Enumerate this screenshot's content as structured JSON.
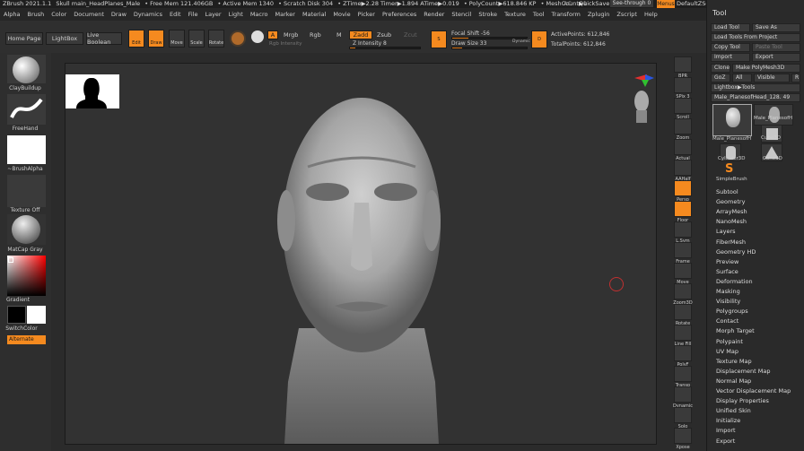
{
  "titlebar": {
    "app": "ZBrush 2021.1.1",
    "file": "Skull main_HeadPlanes_Male",
    "free_mem": "• Free Mem 121.406GB",
    "active_mem": "• Active Mem 1340",
    "scratch": "• Scratch Disk 304",
    "ztime": "• ZTime▶2.28 Timer▶1.894 ATime▶0.019",
    "polycount": "• PolyCount▶618.846 KP",
    "meshcount": "• MeshCount▶1",
    "ac": "AC",
    "quicksave": "QuickSave",
    "see_through": "See-through  0",
    "menus": "Menus",
    "script": "DefaultZScript"
  },
  "menubar": [
    "Alpha",
    "Brush",
    "Color",
    "Document",
    "Draw",
    "Dynamics",
    "Edit",
    "File",
    "Layer",
    "Light",
    "Macro",
    "Marker",
    "Material",
    "Movie",
    "Picker",
    "Preferences",
    "Render",
    "Stencil",
    "Stroke",
    "Texture",
    "Tool",
    "Transform",
    "Zplugin",
    "Zscript",
    "Help"
  ],
  "topshelf": {
    "home": "Home Page",
    "lightbox": "LightBox",
    "live_boolean": "Live Boolean",
    "edit": "Edit",
    "draw": "Draw",
    "move": "Move",
    "scale": "Scale",
    "rotate": "Rotate",
    "a": "A",
    "mrgb": "Mrgb",
    "rgb": "Rgb",
    "m": "M",
    "rgb_intensity": "Rgb Intensity",
    "zadd": "Zadd",
    "zsub": "Zsub",
    "zcut": "Zcut",
    "z_intensity": "Z Intensity 8",
    "z_intensity_frac": 0.08,
    "focal_shift": "Focal Shift -56",
    "focal_frac": 0.22,
    "draw_size": "Draw Size 33",
    "draw_frac": 0.13,
    "dynamic": "Dynamic",
    "active_points": "ActivePoints: 612,846",
    "total_points": "TotalPoints: 612,846"
  },
  "leftshelf": {
    "brush": "ClayBuildup",
    "stroke": "FreeHand",
    "alpha": "~BrushAlpha",
    "texture": "Texture Off",
    "material": "MatCap Gray",
    "gradient": "Gradient",
    "switch_color": "SwitchColor",
    "alternate": "Alternate"
  },
  "rightshelf": [
    "BPR",
    "SPix 3",
    "Scroll",
    "Zoom",
    "Actual",
    "AAHalf",
    "Persp",
    "Floor",
    "L.Sym",
    "Frame",
    "Move",
    "Zoom3D",
    "Rotate",
    "Line Fill",
    "PolyF",
    "Transp",
    "Dynamic",
    "Solo",
    "Xpose"
  ],
  "tool": {
    "title": "Tool",
    "load_tool": "Load Tool",
    "save_as": "Save As",
    "load_from_project": "Load Tools From Project",
    "copy_tool": "Copy Tool",
    "paste_tool": "Paste Tool",
    "import": "Import",
    "export": "Export",
    "clone": "Clone",
    "make_polymesh": "Make PolyMesh3D",
    "goz": "GoZ",
    "all": "All",
    "visible": "Visible",
    "r": "R",
    "lightbox_tools": "Lightbox▶Tools",
    "current_tool": "Male_PlanesofHead_128. 49",
    "thumbs": [
      "Male_PlanesofH",
      "Male_PlanesofH",
      "Cube3D",
      "Cylinder3D",
      "Cone3D",
      "SimpleBrush"
    ],
    "subpalettes": [
      "Subtool",
      "Geometry",
      "ArrayMesh",
      "NanoMesh",
      "Layers",
      "FiberMesh",
      "Geometry HD",
      "Preview",
      "Surface",
      "Deformation",
      "Masking",
      "Visibility",
      "Polygroups",
      "Contact",
      "Morph Target",
      "Polypaint",
      "UV Map",
      "Texture Map",
      "Displacement Map",
      "Normal Map",
      "Vector Displacement Map",
      "Display Properties",
      "Unified Skin",
      "Initialize",
      "Import",
      "Export"
    ]
  },
  "colors": {
    "accent": "#f58a1f",
    "panel": "#2a2a2a",
    "canvas": "#323232"
  }
}
